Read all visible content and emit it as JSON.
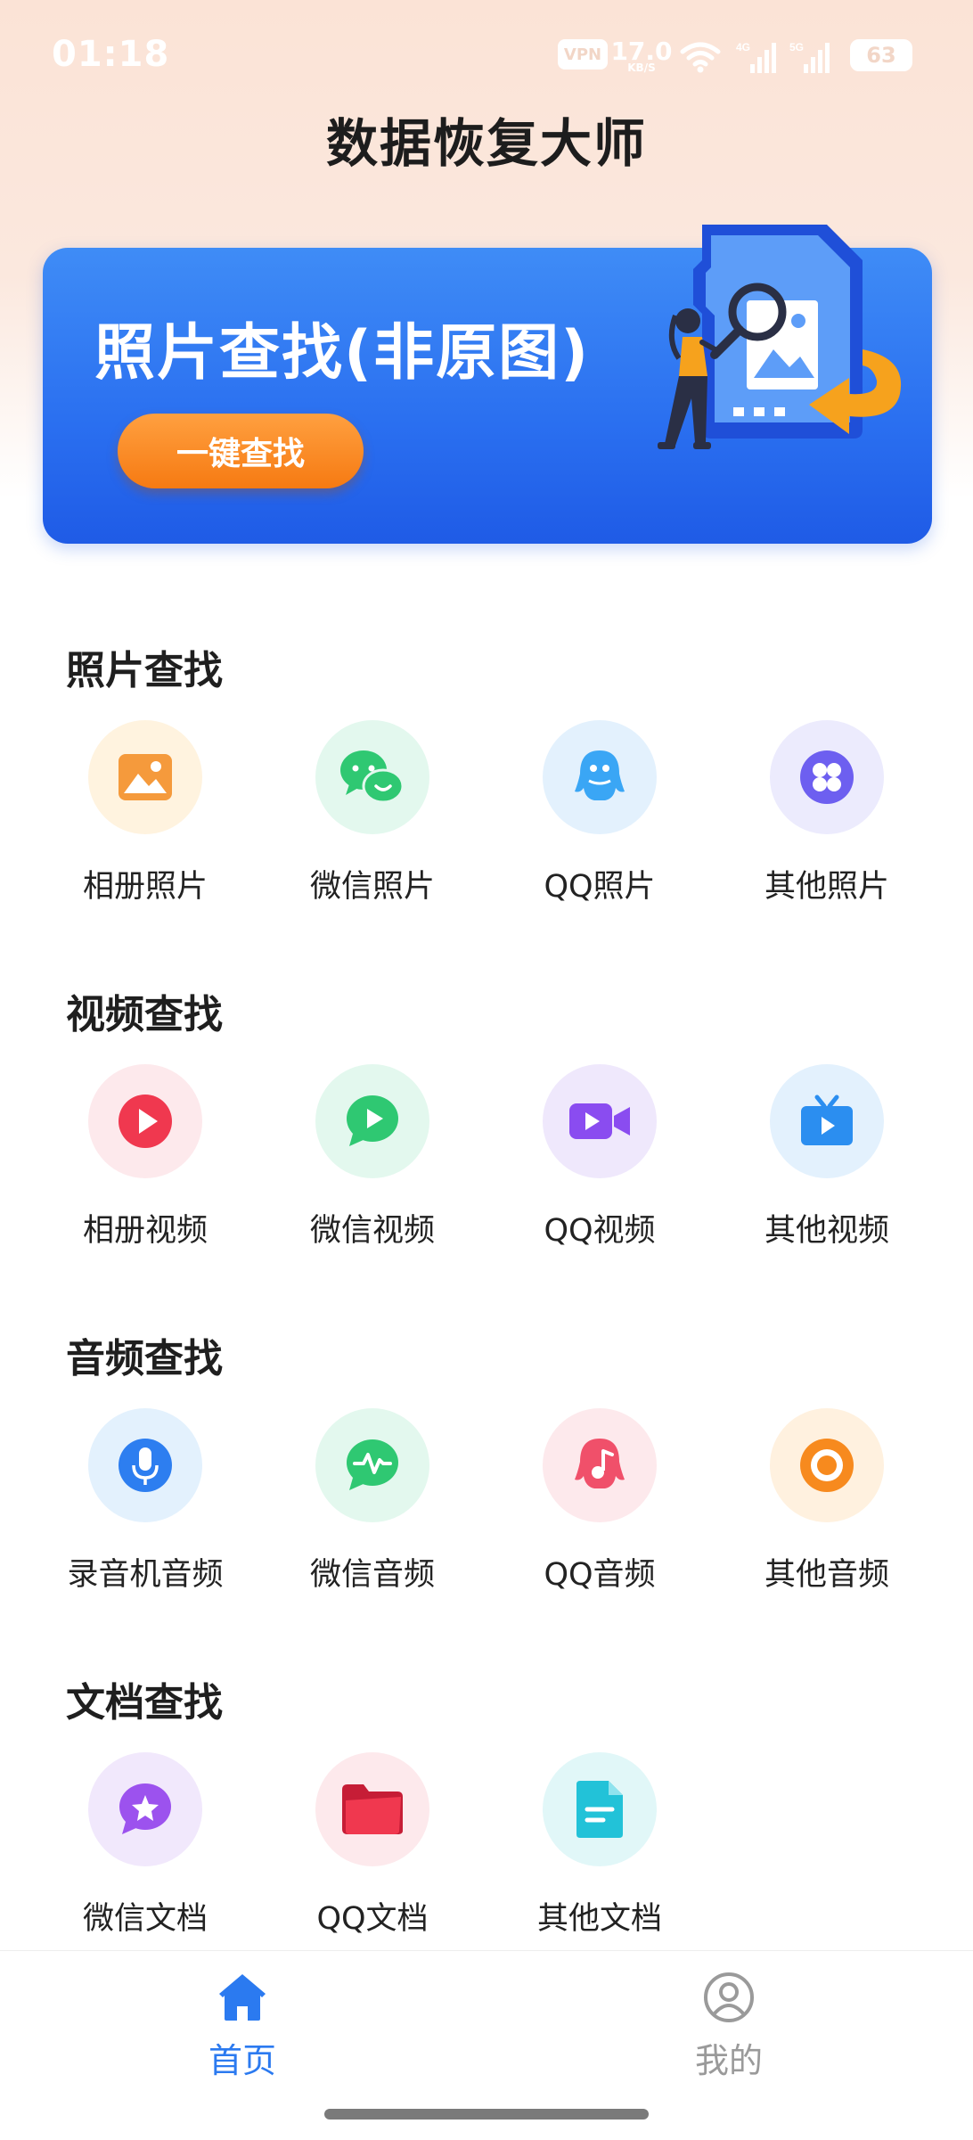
{
  "status_bar": {
    "time": "01:18",
    "vpn": "VPN",
    "speed": "17.0",
    "speed_unit": "KB/S",
    "sig1": "4G",
    "sig2": "5G",
    "battery": "63"
  },
  "app_title": "数据恢复大师",
  "banner": {
    "title": "照片查找(非原图)",
    "button": "一键查找"
  },
  "sections": [
    {
      "title": "照片查找",
      "items": [
        {
          "label": "相册照片",
          "icon": "album-photo-icon",
          "bg": "#fff3df",
          "color": "#f59a3c"
        },
        {
          "label": "微信照片",
          "icon": "wechat-icon",
          "bg": "#e3f8ee",
          "color": "#2fc872"
        },
        {
          "label": "QQ照片",
          "icon": "qq-penguin-icon",
          "bg": "#e3f1fd",
          "color": "#3aa6f5"
        },
        {
          "label": "其他照片",
          "icon": "other-grid-icon",
          "bg": "#ecebfd",
          "color": "#6d5ff0"
        }
      ]
    },
    {
      "title": "视频查找",
      "items": [
        {
          "label": "相册视频",
          "icon": "play-icon",
          "bg": "#fde9ec",
          "color": "#f0384f"
        },
        {
          "label": "微信视频",
          "icon": "wechat-video-icon",
          "bg": "#e3f8ee",
          "color": "#2fc872"
        },
        {
          "label": "QQ视频",
          "icon": "video-camera-icon",
          "bg": "#efe8fc",
          "color": "#8a4cf0"
        },
        {
          "label": "其他视频",
          "icon": "tv-icon",
          "bg": "#e3f1fd",
          "color": "#2b8ef0"
        }
      ]
    },
    {
      "title": "音频查找",
      "items": [
        {
          "label": "录音机音频",
          "icon": "microphone-icon",
          "bg": "#e3f1fd",
          "color": "#2d7ef0"
        },
        {
          "label": "微信音频",
          "icon": "voice-message-icon",
          "bg": "#e3f8ee",
          "color": "#2fc872"
        },
        {
          "label": "QQ音频",
          "icon": "music-penguin-icon",
          "bg": "#fde9ec",
          "color": "#f0506a"
        },
        {
          "label": "其他音频",
          "icon": "vinyl-icon",
          "bg": "#fff1df",
          "color": "#f78a1e"
        }
      ]
    },
    {
      "title": "文档查找",
      "items": [
        {
          "label": "微信文档",
          "icon": "star-chat-icon",
          "bg": "#f1e8fc",
          "color": "#9c52ee"
        },
        {
          "label": "QQ文档",
          "icon": "folder-icon",
          "bg": "#fde9ec",
          "color": "#f0384f"
        },
        {
          "label": "其他文档",
          "icon": "document-icon",
          "bg": "#e1f7f8",
          "color": "#22c2d8"
        }
      ]
    }
  ],
  "nav": {
    "home": "首页",
    "mine": "我的",
    "active_color": "#2b7af0",
    "inactive_color": "#9a9a9a"
  }
}
